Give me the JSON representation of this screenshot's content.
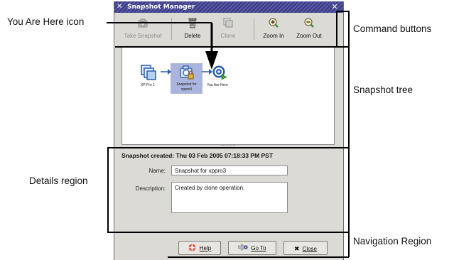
{
  "window": {
    "title": "Snapshot Manager"
  },
  "toolbar": {
    "take_snapshot": "Take Snapshot",
    "delete": "Delete",
    "clone": "Clone",
    "zoom_in": "Zoom In",
    "zoom_out": "Zoom Out"
  },
  "tree": {
    "nodes": [
      {
        "label": "XP Pro 1",
        "icon": "vm-icon"
      },
      {
        "label_line1": "Snapshot for",
        "label_line2": "xppro3",
        "icon": "snapshot-icon",
        "selected": true
      },
      {
        "label": "You Are Here",
        "icon": "you-are-here-icon"
      }
    ]
  },
  "details": {
    "created": "Snapshot created: Thu 03 Feb 2005 07:18:33 PM PST",
    "name_label": "Name:",
    "name_value": "Snapshot for xppro3",
    "description_label": "Description:",
    "description_value": "Created by clone operation."
  },
  "buttons": {
    "help": "Help",
    "goto": "Go To",
    "close": "Close"
  },
  "callouts": {
    "you_are_here": "You Are Here icon",
    "command_buttons": "Command buttons",
    "snapshot_tree": "Snapshot tree",
    "details_region": "Details region",
    "navigation_region": "Navigation Region"
  },
  "colors": {
    "titlebar": "#3c3c8c",
    "window_bg": "#dcdad5",
    "selection": "#aab4dc"
  }
}
